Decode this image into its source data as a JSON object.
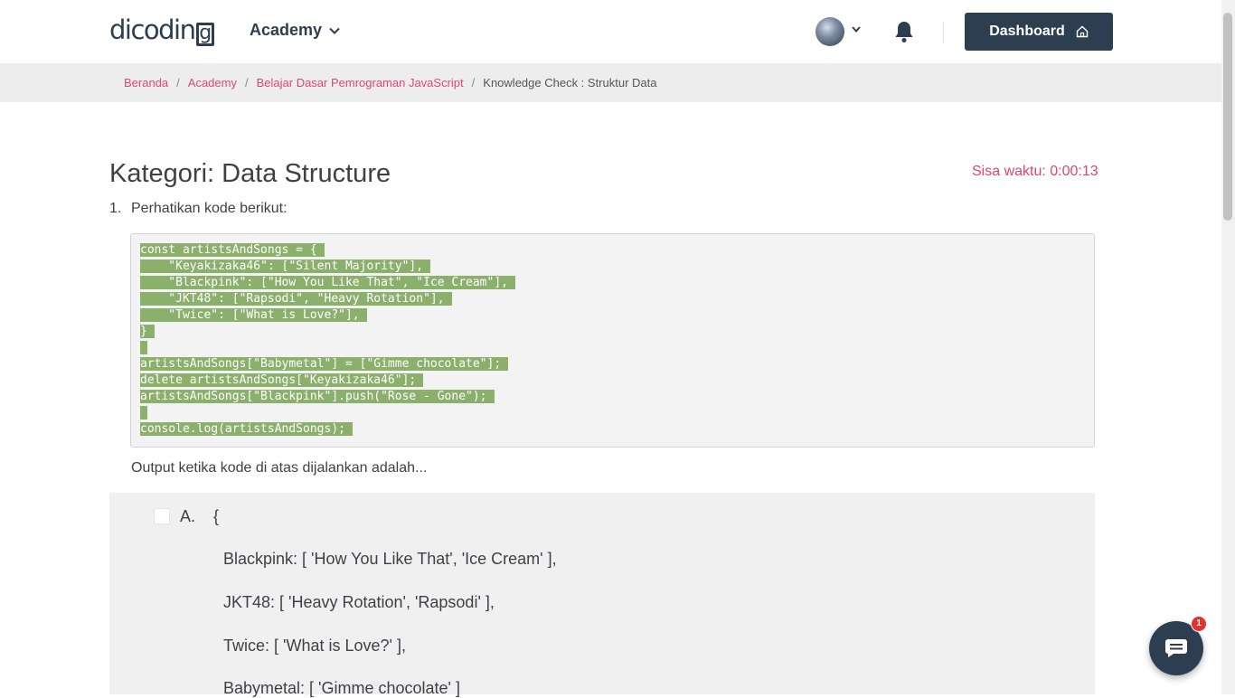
{
  "nav": {
    "logo_text": "dicodin",
    "logo_box_letter": "g",
    "academy_label": "Academy",
    "dashboard_label": "Dashboard"
  },
  "breadcrumb": {
    "items": [
      "Beranda",
      "Academy",
      "Belajar Dasar Pemrograman JavaScript"
    ],
    "current": "Knowledge Check : Struktur Data",
    "separator": "/"
  },
  "quiz": {
    "title": "Kategori: Data Structure",
    "timer": "Sisa waktu: 0:00:13",
    "question_number": "1.",
    "question_text": "Perhatikan kode berikut:",
    "code_lines": [
      "const artistsAndSongs = {",
      "    \"Keyakizaka46\": [\"Silent Majority\"],",
      "    \"Blackpink\": [\"How You Like That\", \"Ice Cream\"],",
      "    \"JKT48\": [\"Rapsodi\", \"Heavy Rotation\"],",
      "    \"Twice\": [\"What is Love?\"],",
      "}",
      "",
      "artistsAndSongs[\"Babymetal\"] = [\"Gimme chocolate\"];",
      "delete artistsAndSongs[\"Keyakizaka46\"];",
      "artistsAndSongs[\"Blackpink\"].push(\"Rose - Gone\");",
      "",
      "console.log(artistsAndSongs);"
    ],
    "output_question": "Output ketika kode di atas dijalankan adalah...",
    "options": [
      {
        "letter": "A.",
        "lines": [
          "{",
          "Blackpink: [ 'How You Like That', 'Ice Cream' ],",
          "JKT48: [ 'Heavy Rotation', 'Rapsodi' ],",
          "Twice: [ 'What is Love?' ],",
          "Babymetal: [ 'Gimme chocolate' ]"
        ]
      }
    ]
  },
  "chat": {
    "badge_count": "1"
  },
  "colors": {
    "primary": "#2d3e50",
    "link": "#e0467c",
    "timer": "#e0466a",
    "code_highlight": "#8bb06b"
  }
}
